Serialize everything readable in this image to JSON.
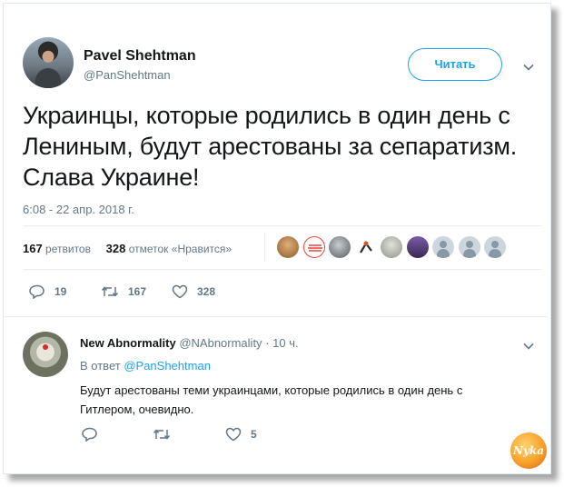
{
  "tweet": {
    "author_name": "Pavel Shehtman",
    "author_handle": "@PanShehtman",
    "follow_label": "Читать",
    "text": "Украинцы, которые родились в один день с Лениным, будут арестованы за сепаратизм. Слава Украине!",
    "timestamp": "6:08 - 22 апр. 2018 г.",
    "retweet_count": "167",
    "retweet_label": "ретвитов",
    "like_count": "328",
    "like_label": "отметок «Нравится»",
    "actions": {
      "replies": "19",
      "retweets": "167",
      "likes": "328"
    }
  },
  "likers": [
    {
      "name": "liker-avatar-1",
      "color": "#c98b4a"
    },
    {
      "name": "liker-avatar-2",
      "color": "#e8433d"
    },
    {
      "name": "liker-avatar-3",
      "color": "#7a7d83"
    },
    {
      "name": "liker-avatar-4",
      "color": "#2b2b2b"
    },
    {
      "name": "liker-avatar-5",
      "color": "#9a9f96"
    },
    {
      "name": "liker-avatar-6",
      "color": "#4b2f6e"
    }
  ],
  "reply": {
    "author_name": "New Abnormality",
    "author_handle": "@NAbnormality",
    "time": "· 10 ч.",
    "in_reply_prefix": "В ответ",
    "in_reply_handle": "@PanShehtman",
    "text": "Будут арестованы теми украинцами, которые родились в один день с Гитлером, очевидно.",
    "actions": {
      "replies": "",
      "retweets": "",
      "likes": "5"
    }
  },
  "watermark": {
    "text": "Nyka"
  },
  "colors": {
    "accent": "#1da1f2",
    "secondary_text": "#657786",
    "primary_text": "#14171a"
  }
}
